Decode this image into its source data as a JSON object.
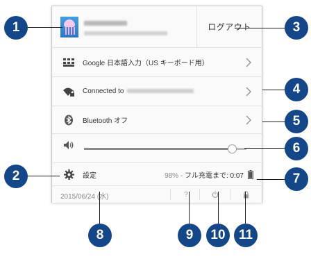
{
  "user": {
    "logout_label": "ログアウト"
  },
  "rows": {
    "ime_label": "Google 日本語入力（US キーボード用）",
    "wifi_label": "Connected to",
    "bluetooth_label": "Bluetooth オフ",
    "volume_level": 0.91,
    "settings_label": "設定",
    "battery_percent": "98% -",
    "battery_status": "フル充電まで: 0:07"
  },
  "footer": {
    "date": "2015/06/24 (水)",
    "help_label": "?"
  },
  "callouts": [
    "1",
    "2",
    "3",
    "4",
    "5",
    "6",
    "7",
    "8",
    "9",
    "10",
    "11"
  ],
  "colors": {
    "callout": "#14468a",
    "panel_bg": "#fafafa",
    "avatar_bg": "#2b78c4"
  },
  "icons": {
    "ime": "keyboard-grid-icon",
    "wifi": "wifi-locked-icon",
    "bluetooth": "bluetooth-icon",
    "volume": "speaker-icon",
    "settings": "gear-icon",
    "battery": "battery-icon",
    "help": "help-icon",
    "power": "power-icon",
    "lock": "lock-icon",
    "chevron": "chevron-right-icon"
  }
}
